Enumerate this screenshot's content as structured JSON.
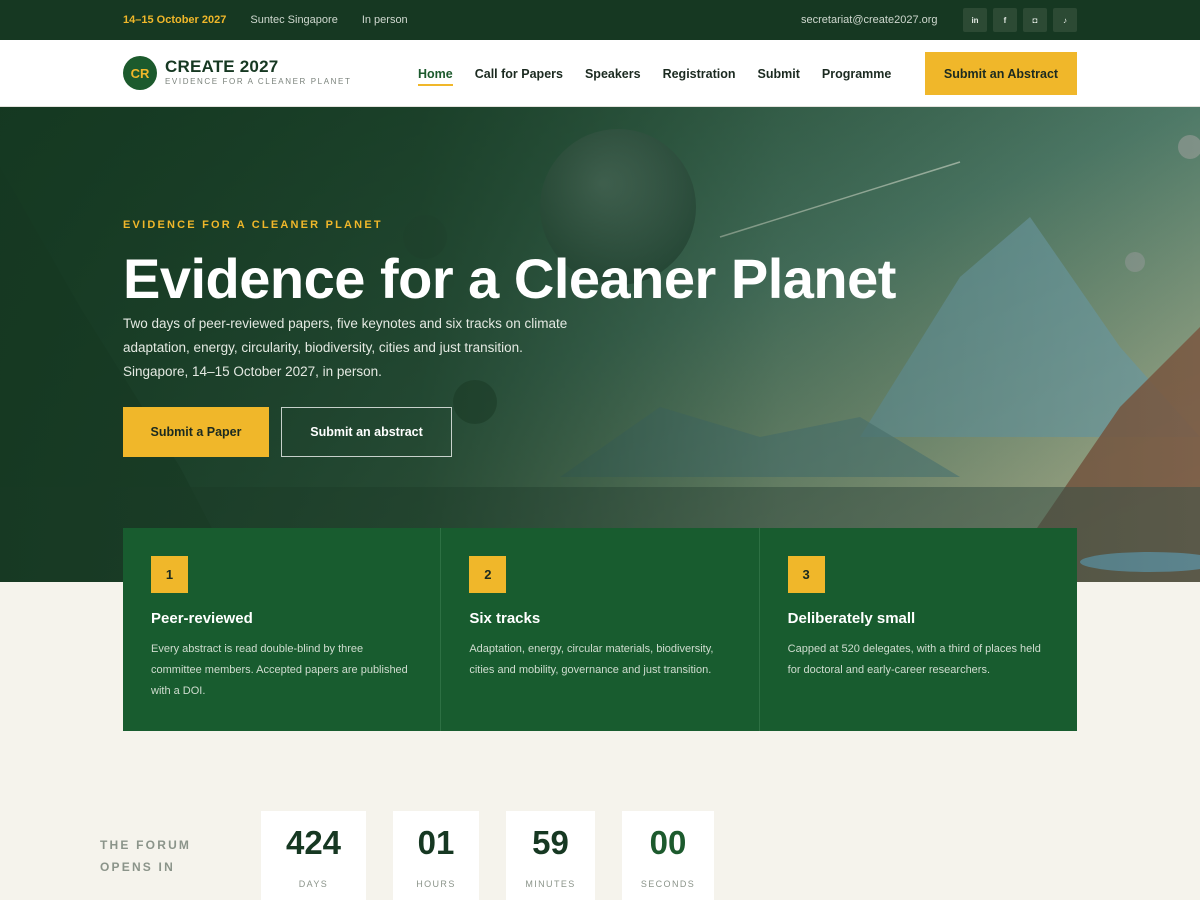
{
  "topbar": {
    "date": "14–15 October 2027",
    "venue": "Suntec Singapore",
    "format": "In person",
    "email": "secretariat@create2027.org",
    "social": [
      {
        "icon": "linkedin-icon",
        "glyph": "in"
      },
      {
        "icon": "facebook-icon",
        "glyph": "f"
      },
      {
        "icon": "instagram-icon",
        "glyph": "◘"
      },
      {
        "icon": "tiktok-icon",
        "glyph": "♪"
      }
    ]
  },
  "header": {
    "logo_badge": "CR",
    "logo_title": "CREATE 2027",
    "logo_subtitle": "EVIDENCE FOR A CLEANER PLANET",
    "nav": [
      "Home",
      "Call for Papers",
      "Speakers",
      "Registration",
      "Submit",
      "Programme"
    ],
    "active_nav": "Home",
    "cta": "Submit an Abstract"
  },
  "hero": {
    "eyebrow": "EVIDENCE FOR A CLEANER PLANET",
    "title": "Evidence for a Cleaner Planet",
    "description_lines": [
      "Two days of peer-reviewed papers, five keynotes and six tracks on climate",
      "adaptation, energy, circularity, biodiversity, cities and just transition.",
      "Singapore, 14–15 October 2027, in person."
    ],
    "primary_button": "Submit a Paper",
    "secondary_button": "Submit an abstract"
  },
  "features": [
    {
      "number": "1",
      "title": "Peer-reviewed",
      "text": "Every abstract is read double-blind by three committee members. Accepted papers are published with a DOI."
    },
    {
      "number": "2",
      "title": "Six tracks",
      "text": "Adaptation, energy, circular materials, biodiversity, cities and mobility, governance and just transition."
    },
    {
      "number": "3",
      "title": "Deliberately small",
      "text": "Capped at 520 delegates, with a third of places held for doctoral and early-career researchers."
    }
  ],
  "countdown": {
    "label_line1": "THE FORUM",
    "label_line2": "OPENS IN",
    "units": [
      {
        "value": "424",
        "label": "DAYS"
      },
      {
        "value": "01",
        "label": "HOURS"
      },
      {
        "value": "59",
        "label": "MINUTES"
      },
      {
        "value": "00",
        "label": "SECONDS"
      }
    ]
  },
  "colors": {
    "brand_dark": "#163822",
    "brand_green": "#1c5a2d",
    "accent": "#f0b72a",
    "background": "#f5f3ec"
  }
}
